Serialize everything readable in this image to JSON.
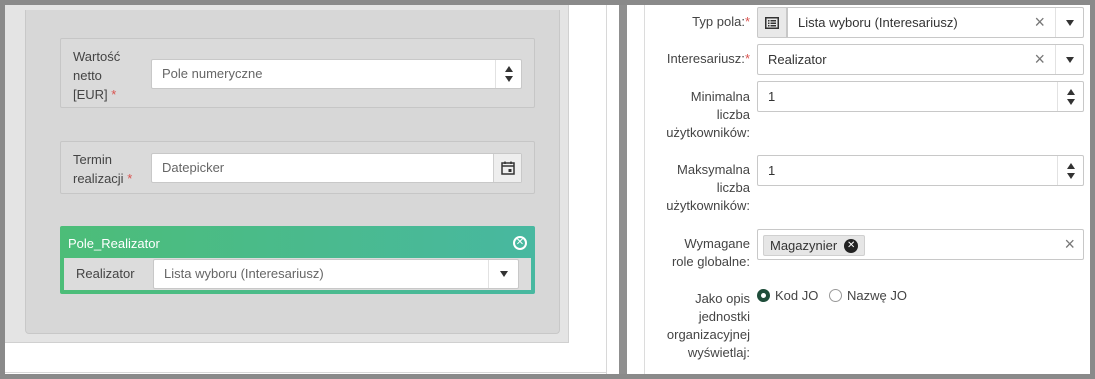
{
  "left_form": {
    "net_value": {
      "label_lines": [
        "Wartość",
        "netto",
        "[EUR]"
      ],
      "required_mark": "*",
      "placeholder": "Pole numeryczne"
    },
    "deadline": {
      "label_lines": [
        "Termin",
        "realizacji"
      ],
      "required_mark": "*",
      "placeholder": "Datepicker"
    },
    "realizator_card": {
      "title": "Pole_Realizator",
      "field_label": "Realizator",
      "select_value": "Lista wyboru (Interesariusz)",
      "colors": {
        "gradient_start": "#4cbd78",
        "gradient_end": "#48b8a0"
      }
    }
  },
  "settings_panel": {
    "field_type": {
      "label": "Typ pola:",
      "required_mark": "*",
      "value": "Lista wyboru (Interesariusz)",
      "icon": "list-icon"
    },
    "stakeholder": {
      "label": "Interesariusz:",
      "required_mark": "*",
      "value": "Realizator"
    },
    "min_users": {
      "label_lines": [
        "Minimalna",
        "liczba",
        "użytkowników:"
      ],
      "value": "1"
    },
    "max_users": {
      "label_lines": [
        "Maksymalna",
        "liczba",
        "użytkowników:"
      ],
      "value": "1"
    },
    "global_roles": {
      "label_lines": [
        "Wymagane",
        "role globalne:"
      ],
      "tags": [
        "Magazynier"
      ]
    },
    "org_unit_desc": {
      "label_lines": [
        "Jako opis",
        "jednostki",
        "organizacyjnej",
        "wyświetlaj:"
      ],
      "options": [
        {
          "label": "Kod JO",
          "checked": true
        },
        {
          "label": "Nazwę JO",
          "checked": false
        }
      ]
    }
  }
}
